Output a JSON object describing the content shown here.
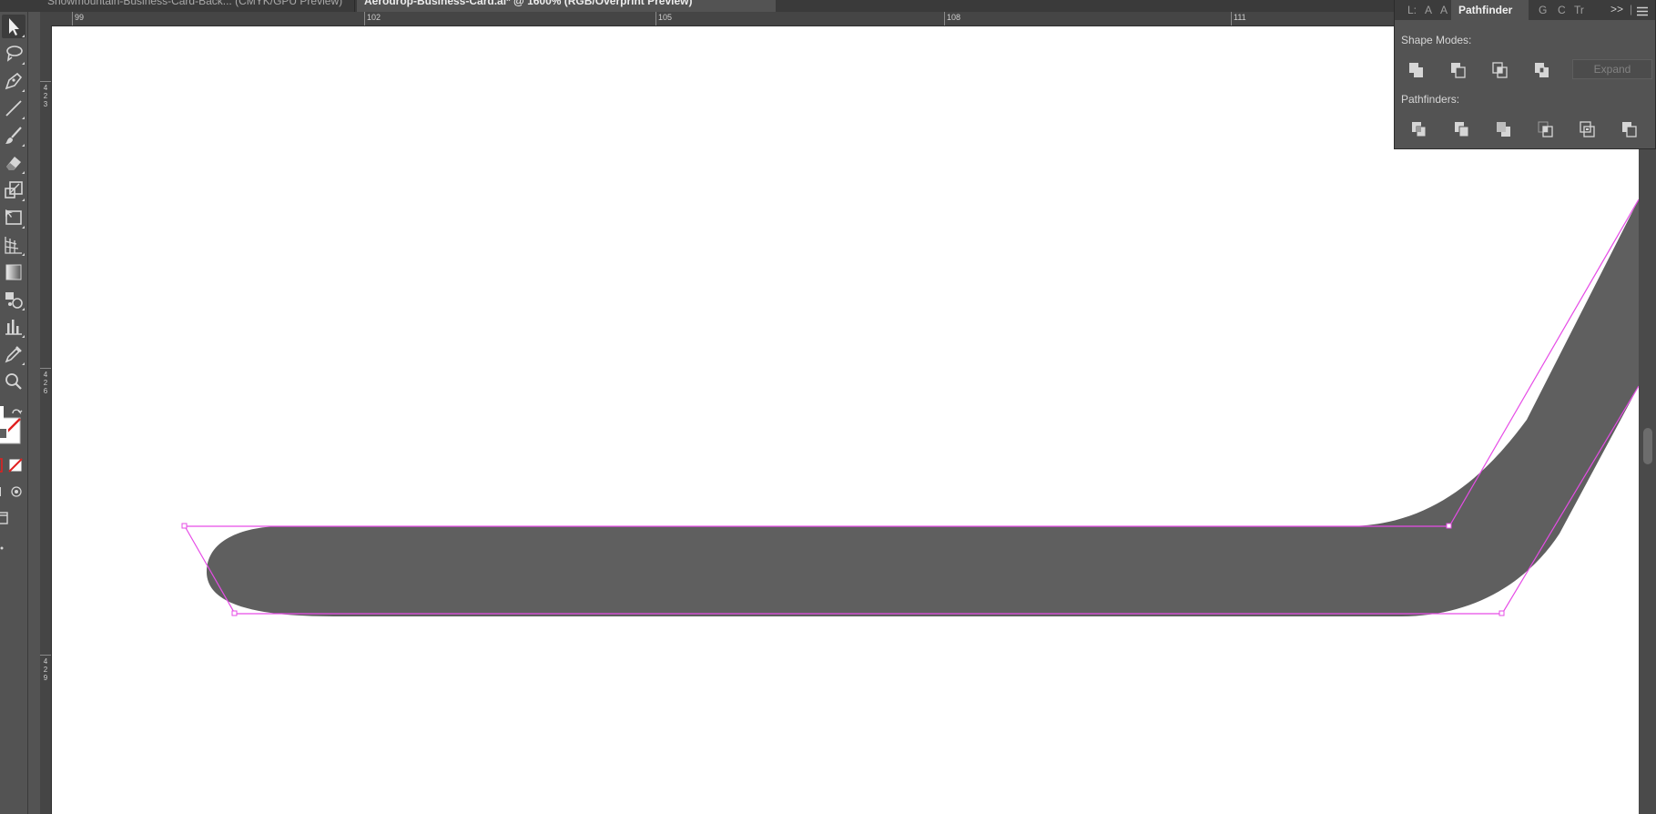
{
  "document_tabs": [
    {
      "label": "Snowmountain-Business-Card-Back... (CMYK/GPU Preview)",
      "active": false
    },
    {
      "label": "Aerodrop-Business-Card.ai* @ 1600% (RGB/Overprint Preview)",
      "active": true
    }
  ],
  "ruler": {
    "horizontal_labels": [
      "99",
      "102",
      "105",
      "108",
      "111"
    ],
    "vertical_labels": [
      [
        "4",
        "2",
        "3"
      ],
      [
        "4",
        "2",
        "6"
      ],
      [
        "4",
        "2",
        "9"
      ]
    ]
  },
  "tools": [
    {
      "name": "selection-tool-icon",
      "active": true
    },
    {
      "name": "lasso-tool-icon"
    },
    {
      "name": "pen-tool-icon"
    },
    {
      "name": "line-tool-icon"
    },
    {
      "name": "paintbrush-tool-icon"
    },
    {
      "name": "eraser-tool-icon"
    },
    {
      "name": "scale-tool-icon"
    },
    {
      "name": "free-transform-tool-icon"
    },
    {
      "name": "perspective-grid-tool-icon"
    },
    {
      "name": "gradient-tool-icon"
    },
    {
      "name": "symbol-sprayer-tool-icon"
    },
    {
      "name": "column-graph-tool-icon"
    },
    {
      "name": "eyedropper-tool-icon"
    },
    {
      "name": "zoom-tool-icon"
    }
  ],
  "pathfinder_panel": {
    "tabs_left": [
      "L:",
      "A",
      "A"
    ],
    "active_tab": "Pathfinder",
    "tabs_right": [
      "G",
      "C",
      "Tr"
    ],
    "collapse_label": ">>",
    "shape_modes_label": "Shape Modes:",
    "shape_modes": [
      "unite-icon",
      "minus-front-icon",
      "intersect-icon",
      "exclude-icon"
    ],
    "expand_label": "Expand",
    "pathfinders_label": "Pathfinders:",
    "pathfinders": [
      "divide-icon",
      "trim-icon",
      "merge-icon",
      "crop-icon",
      "outline-icon",
      "minus-back-icon"
    ]
  },
  "artwork": {
    "shape_fill": "#5f5f5f",
    "selection_color": "#e64ce6"
  }
}
